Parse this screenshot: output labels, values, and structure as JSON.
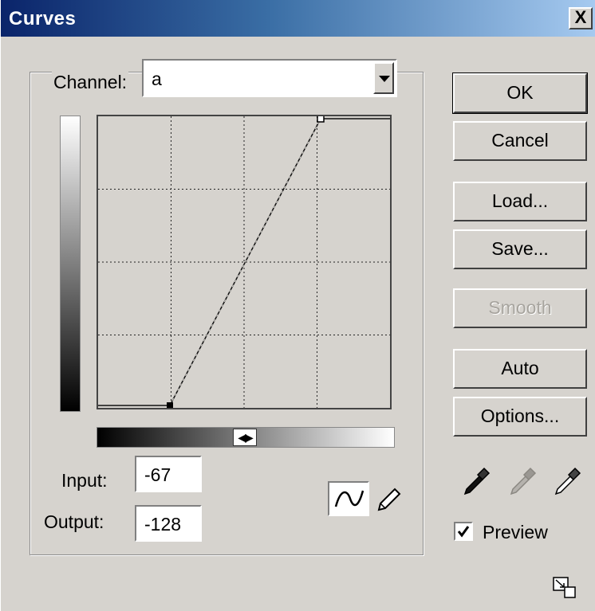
{
  "window": {
    "title": "Curves",
    "close_label": "X"
  },
  "channel": {
    "label": "Channel:",
    "value": "a"
  },
  "curve": {
    "input_value": "-67",
    "output_value": "-128"
  },
  "fields": {
    "input_label": "Input:",
    "output_label": "Output:"
  },
  "buttons": {
    "ok": "OK",
    "cancel": "Cancel",
    "load": "Load...",
    "save": "Save...",
    "smooth": "Smooth",
    "auto": "Auto",
    "options": "Options..."
  },
  "preview": {
    "label": "Preview",
    "checked": true
  },
  "icons": {
    "curve_tool": "curve-tool-icon",
    "pencil_tool": "pencil-icon",
    "black_point": "eyedropper-black-icon",
    "gray_point": "eyedropper-gray-icon",
    "white_point": "eyedropper-white-icon",
    "resize": "resize-icon"
  },
  "colors": {
    "titlebar_start": "#0a246a",
    "titlebar_end": "#a6caf0",
    "dialog_bg": "#d6d3ce"
  }
}
